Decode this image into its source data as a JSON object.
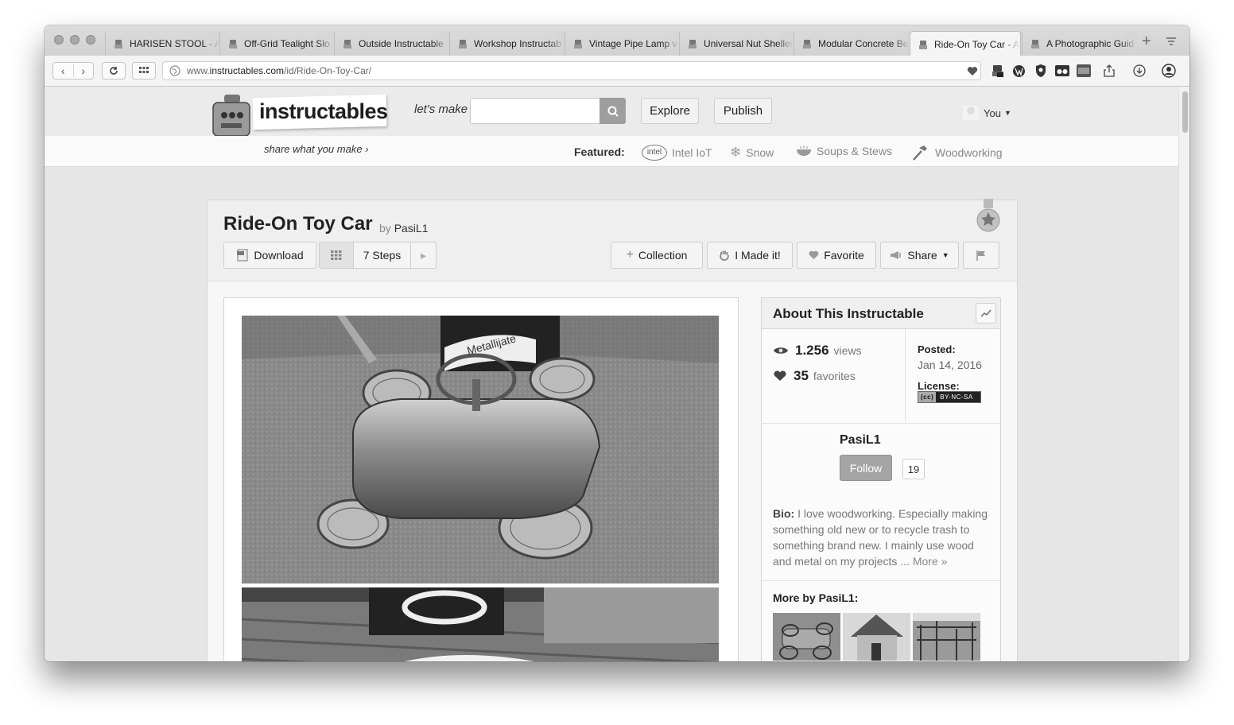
{
  "browser": {
    "tabs": [
      {
        "title": "HARISEN STOOL - A"
      },
      {
        "title": "Off-Grid Tealight Slo"
      },
      {
        "title": "Outside Instructable"
      },
      {
        "title": "Workshop Instructab"
      },
      {
        "title": "Vintage Pipe Lamp v"
      },
      {
        "title": "Universal Nut Sheller"
      },
      {
        "title": "Modular Concrete Be"
      },
      {
        "title": "Ride-On Toy Car - A",
        "active": true
      },
      {
        "title": "A Photographic Guid"
      }
    ],
    "url": {
      "prefix": "www.",
      "host": "instructables.com",
      "path": "/id/Ride-On-Toy-Car/"
    }
  },
  "site": {
    "logo": "instructables",
    "tagline": "share what you make",
    "lets_make": "let's make",
    "search_placeholder": "",
    "nav": {
      "explore": "Explore",
      "publish": "Publish",
      "user": "You"
    },
    "featured_label": "Featured:",
    "featured": [
      {
        "label": "Intel IoT",
        "icon": "intel-logo-icon"
      },
      {
        "label": "Snow",
        "icon": "snowflake-icon"
      },
      {
        "label": "Soups & Stews",
        "icon": "bowl-icon"
      },
      {
        "label": "Woodworking",
        "icon": "hammer-icon"
      }
    ]
  },
  "instructable": {
    "title": "Ride-On Toy Car",
    "by": "by",
    "author": "PasiL1",
    "actions": {
      "download": "Download",
      "steps": "7 Steps",
      "collection": "Collection",
      "made_it": "I Made it!",
      "favorite": "Favorite",
      "share": "Share"
    },
    "photo_label": "Metallijate"
  },
  "about": {
    "heading": "About This Instructable",
    "views_num": "1.256",
    "views_label": "views",
    "favorites_num": "35",
    "favorites_label": "favorites",
    "posted_label": "Posted:",
    "posted_date": "Jan 14, 2016",
    "license_label": "License:",
    "license_badge": "BY-NC-SA",
    "author": "PasiL1",
    "follow": "Follow",
    "followers": "19",
    "bio_label": "Bio:",
    "bio_text": " I love woodworking. Especially making something old new or to recycle trash to something brand new. I mainly use wood and metal on my projects ...",
    "bio_more": " More »",
    "more_by": "More by PasiL1:"
  }
}
